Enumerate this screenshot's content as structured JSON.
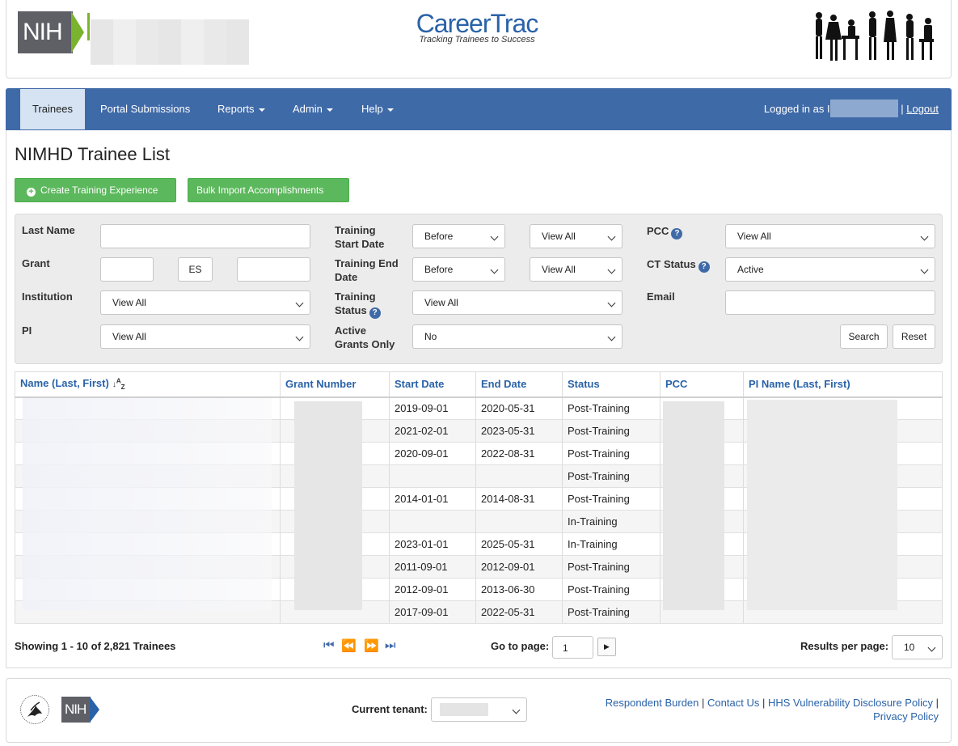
{
  "header": {
    "logo_text": "NIH",
    "app_title": "CareerTrac",
    "app_subtitle": "Tracking Trainees to Success"
  },
  "nav": {
    "items": [
      {
        "label": "Trainees",
        "active": true,
        "dropdown": false
      },
      {
        "label": "Portal Submissions",
        "active": false,
        "dropdown": false
      },
      {
        "label": "Reports",
        "active": false,
        "dropdown": true
      },
      {
        "label": "Admin",
        "active": false,
        "dropdown": true
      },
      {
        "label": "Help",
        "active": false,
        "dropdown": true
      }
    ],
    "logged_in_prefix": "Logged in as I",
    "separator": "|",
    "logout_label": "Logout"
  },
  "page": {
    "title": "NIMHD Trainee List",
    "create_button": "Create Training Experience",
    "bulk_button": "Bulk Import Accomplishments"
  },
  "filters": {
    "last_name_label": "Last Name",
    "grant_label": "Grant",
    "grant_mid_value": "ES",
    "institution_label": "Institution",
    "institution_value": "View All",
    "pi_label": "PI",
    "pi_value": "View All",
    "training_start_label_1": "Training",
    "training_start_label_2": "Start Date",
    "training_start_op": "Before",
    "training_start_value": "View All",
    "training_end_label_1": "Training End",
    "training_end_label_2": "Date",
    "training_end_op": "Before",
    "training_end_value": "View All",
    "training_status_label_1": "Training",
    "training_status_label_2": "Status",
    "training_status_value": "View All",
    "active_grants_label_1": "Active",
    "active_grants_label_2": "Grants Only",
    "active_grants_value": "No",
    "pcc_label": "PCC",
    "pcc_value": "View All",
    "ct_status_label": "CT Status",
    "ct_status_value": "Active",
    "email_label": "Email",
    "help_glyph": "?",
    "search_button": "Search",
    "reset_button": "Reset"
  },
  "table": {
    "columns": [
      "Name (Last, First)",
      "Grant Number",
      "Start Date",
      "End Date",
      "Status",
      "PCC",
      "PI Name (Last, First)"
    ],
    "rows": [
      {
        "start": "2019-09-01",
        "end": "2020-05-31",
        "status": "Post-Training"
      },
      {
        "start": "2021-02-01",
        "end": "2023-05-31",
        "status": "Post-Training"
      },
      {
        "start": "2020-09-01",
        "end": "2022-08-31",
        "status": "Post-Training"
      },
      {
        "start": "",
        "end": "",
        "status": "Post-Training"
      },
      {
        "start": "2014-01-01",
        "end": "2014-08-31",
        "status": "Post-Training"
      },
      {
        "start": "",
        "end": "",
        "status": "In-Training"
      },
      {
        "start": "2023-01-01",
        "end": "2025-05-31",
        "status": "In-Training"
      },
      {
        "start": "2011-09-01",
        "end": "2012-09-01",
        "status": "Post-Training"
      },
      {
        "start": "2012-09-01",
        "end": "2013-06-30",
        "status": "Post-Training"
      },
      {
        "start": "2017-09-01",
        "end": "2022-05-31",
        "status": "Post-Training"
      }
    ]
  },
  "pager": {
    "showing_text": "Showing 1 - 10 of 2,821 Trainees",
    "goto_label": "Go to page:",
    "goto_value": "1",
    "results_label": "Results per page:",
    "results_value": "10"
  },
  "footer": {
    "tenant_label": "Current tenant:",
    "logo_text": "NIH",
    "link_respondent": "Respondent Burden",
    "link_contact": "Contact Us",
    "link_vdp": "HHS Vulnerability Disclosure Policy",
    "link_privacy": "Privacy Policy",
    "separator": "|"
  },
  "colors": {
    "nav_bg": "#3f6aa8",
    "accent_green": "#5cb85c",
    "link_blue": "#2a62a8"
  }
}
